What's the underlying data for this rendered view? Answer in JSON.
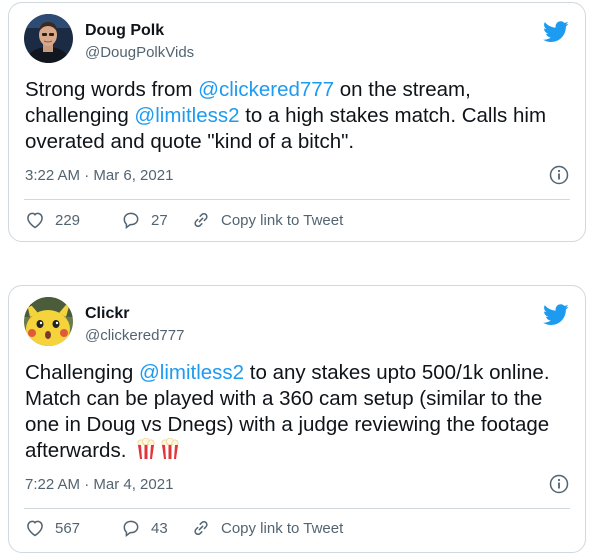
{
  "tweets": [
    {
      "name": "Doug Polk",
      "handle": "@DougPolkVids",
      "text_1": "Strong words from ",
      "mention_1": "@clickered777",
      "text_2": " on the stream, challenging ",
      "mention_2": "@limitless2",
      "text_3": " to a high stakes match. Calls him overated and quote \"kind of a bitch\".",
      "timestamp": "3:22 AM · Mar 6, 2021",
      "likes": "229",
      "replies": "27",
      "copy_link": "Copy link to Tweet"
    },
    {
      "name": "Clickr",
      "handle": "@clickered777",
      "text_1": "Challenging ",
      "mention_1": "@limitless2",
      "text_2": " to any stakes upto 500/1k online. Match can be played with a 360 cam setup (similar to the one in Doug vs Dnegs) with a judge reviewing the footage afterwards. ",
      "emoji": "popcorn-icon popcorn-icon",
      "timestamp": "7:22 AM · Mar 4, 2021",
      "likes": "567",
      "replies": "43",
      "copy_link": "Copy link to Tweet"
    }
  ],
  "colors": {
    "accent": "#1d9bf0",
    "text": "#0f1419",
    "secondary": "#536471",
    "border": "#cfd9de"
  },
  "icons": [
    "twitter-bird-icon",
    "info-icon",
    "heart-icon",
    "reply-bubble-icon",
    "link-icon",
    "popcorn-icon"
  ]
}
